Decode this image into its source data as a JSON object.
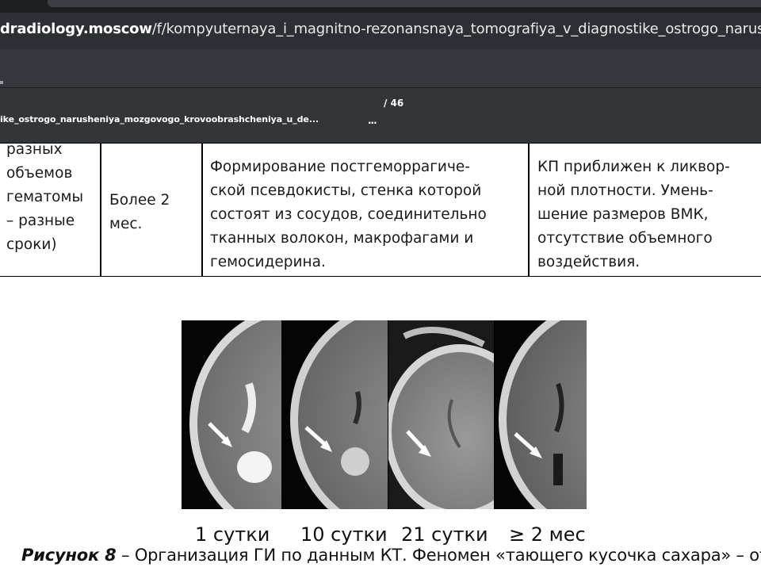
{
  "browser": {
    "url_domain": "dradiology.moscow",
    "url_path": "/f/kompyuternaya_i_magnitno-rezonansnaya_tomografiya_v_diagnostike_ostrogo_narus"
  },
  "pdf_viewer": {
    "filename": "ike_ostrogo_narusheniya_mozgovogo_krovoobrashcheniya_u_de...",
    "more_indicator": "...",
    "page_total": "/ 46"
  },
  "table_row": {
    "col1_lines": [
      "разных",
      "объемов",
      "гематомы",
      "– разные",
      "сроки)"
    ],
    "col2_lines": [
      "Более 2",
      "мес."
    ],
    "col3_lines": [
      "Формирование постгеморрагиче-",
      "ской псевдокисты, стенка которой",
      "состоят из сосудов, соединительно",
      "тканных волокон, макрофагами и",
      "гемосидерина."
    ],
    "col4_lines": [
      "КП приближен к ликвор-",
      "ной плотности. Умень-",
      "шение размеров ВМК,",
      "отсутствие объемного",
      "воздействия."
    ]
  },
  "figure": {
    "labels": [
      "1 сутки",
      "10 сутки",
      "21 сутки",
      "≥ 2 мес"
    ],
    "lesion_brightness": [
      "hyperdense",
      "mixed",
      "isodense",
      "hypodense"
    ]
  },
  "caption": {
    "prefix": "Рисунок 8",
    "text": " – Организация ГИ по данным КТ. Феномен «тающего кусочка сахара» – от"
  }
}
